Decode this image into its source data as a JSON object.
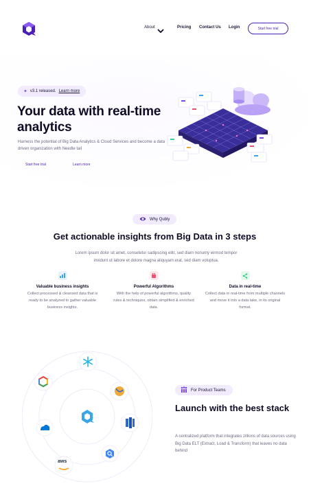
{
  "header": {
    "nav": {
      "about": "About",
      "pricing": "Pricing",
      "contact": "Contact Us",
      "login": "Login"
    },
    "cta_label": "Start free trial",
    "icons": {
      "logo": "brand-logo-icon",
      "about_menu": "chevron-down-icon"
    }
  },
  "hero": {
    "badge_version": "v3.1 released.",
    "badge_link": "Learn more",
    "title": "Your data with real-time analytics",
    "subtitle": "Harness the potential of Big Data Analytics & Cloud Services and become a data driven organization with Needle tail",
    "primary_button": "Start free trial",
    "secondary_button": "Learn more"
  },
  "steps": {
    "badge": "Why Qubly",
    "title": "Get actionable insights from Big Data in 3 steps",
    "subtitle": "Lorem ipsum dolor sit amet, consetetur sadipscing elitr, sed diam nonumy eirmod tempor invidunt ut labore et dolore magna aliquyam erat, sed diam voluptua.",
    "features": [
      {
        "title": "Valuable business insights",
        "desc": "Collect processed & cleansed data that is ready to be analyzed to gather valuable business insights.",
        "icon": "bar-chart-icon"
      },
      {
        "title": "Powerful Algorithms",
        "desc": "With the help of powerful algorithms, quality rules & techniques, obtain simplified & enriched data.",
        "icon": "algorithm-icon"
      },
      {
        "title": "Data in real-time",
        "desc": "Collect data in real-time from multiple channels and move it into a data lake, in its original format.",
        "icon": "share-icon"
      }
    ]
  },
  "stack": {
    "badge": "For Product Teams",
    "title": "Launch with the best stack",
    "desc": "A centralized platform that integrates zillions of data sources using Big Data ELT (Extract, Load & Transform) that leaves no data behind",
    "integrations_label": "aws"
  },
  "colors": {
    "brand": "#4b1fb5",
    "accent": "#7a48e8",
    "badge_bg": "#f1ebfd",
    "heading": "#0f0b24",
    "body_text": "#6e6a80"
  }
}
